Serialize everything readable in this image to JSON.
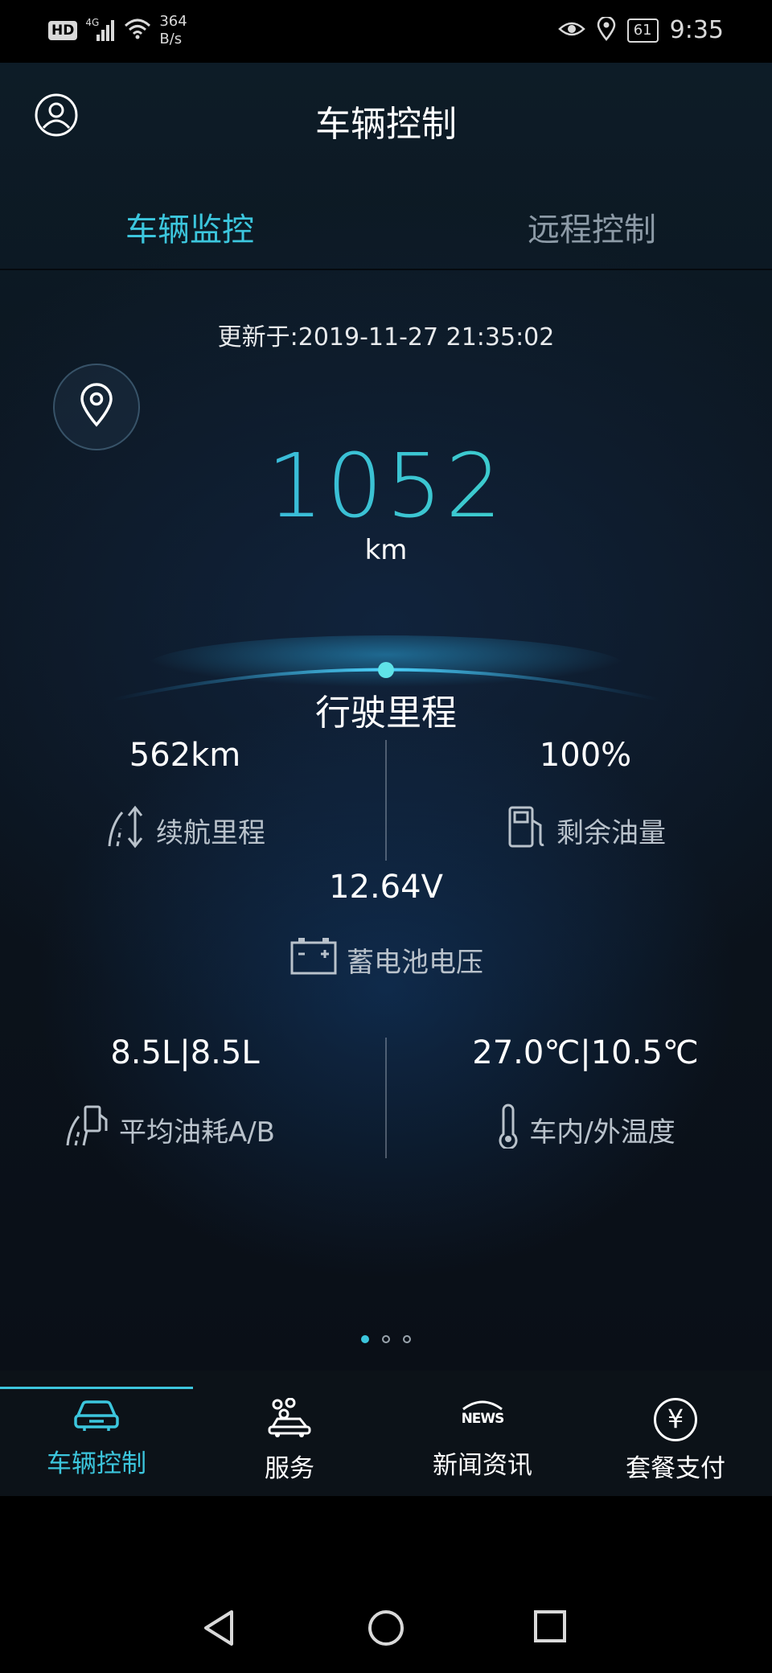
{
  "status_bar": {
    "hd": "HD",
    "network_type": "4G",
    "speed_value": "364",
    "speed_unit": "B/s",
    "battery": "61",
    "time": "9:35"
  },
  "header": {
    "title": "车辆控制"
  },
  "tabs": [
    {
      "label": "车辆监控",
      "active": true
    },
    {
      "label": "远程控制",
      "active": false
    }
  ],
  "update_time": "更新于:2019-11-27 21:35:02",
  "odometer": {
    "value": "1052",
    "unit": "km",
    "label": "行驶里程"
  },
  "stats": {
    "range": {
      "value": "562km",
      "label": "续航里程"
    },
    "fuel": {
      "value": "100%",
      "label": "剩余油量"
    },
    "battery_voltage": {
      "value": "12.64V",
      "label": "蓄电池电压"
    },
    "avg_consumption": {
      "value": "8.5L|8.5L",
      "label": "平均油耗A/B"
    },
    "temperature": {
      "value": "27.0℃|10.5℃",
      "label": "车内/外温度"
    }
  },
  "pager": {
    "count": 3,
    "active_index": 0
  },
  "bottom_nav": [
    {
      "label": "车辆控制",
      "icon": "car-icon",
      "active": true
    },
    {
      "label": "服务",
      "icon": "service-icon",
      "active": false
    },
    {
      "label": "新闻资讯",
      "icon": "news-icon",
      "news_text": "NEWS",
      "active": false
    },
    {
      "label": "套餐支付",
      "icon": "yuan-icon",
      "symbol": "¥",
      "active": false
    }
  ],
  "colors": {
    "accent": "#3cc6dd",
    "background": "#0b1016"
  }
}
